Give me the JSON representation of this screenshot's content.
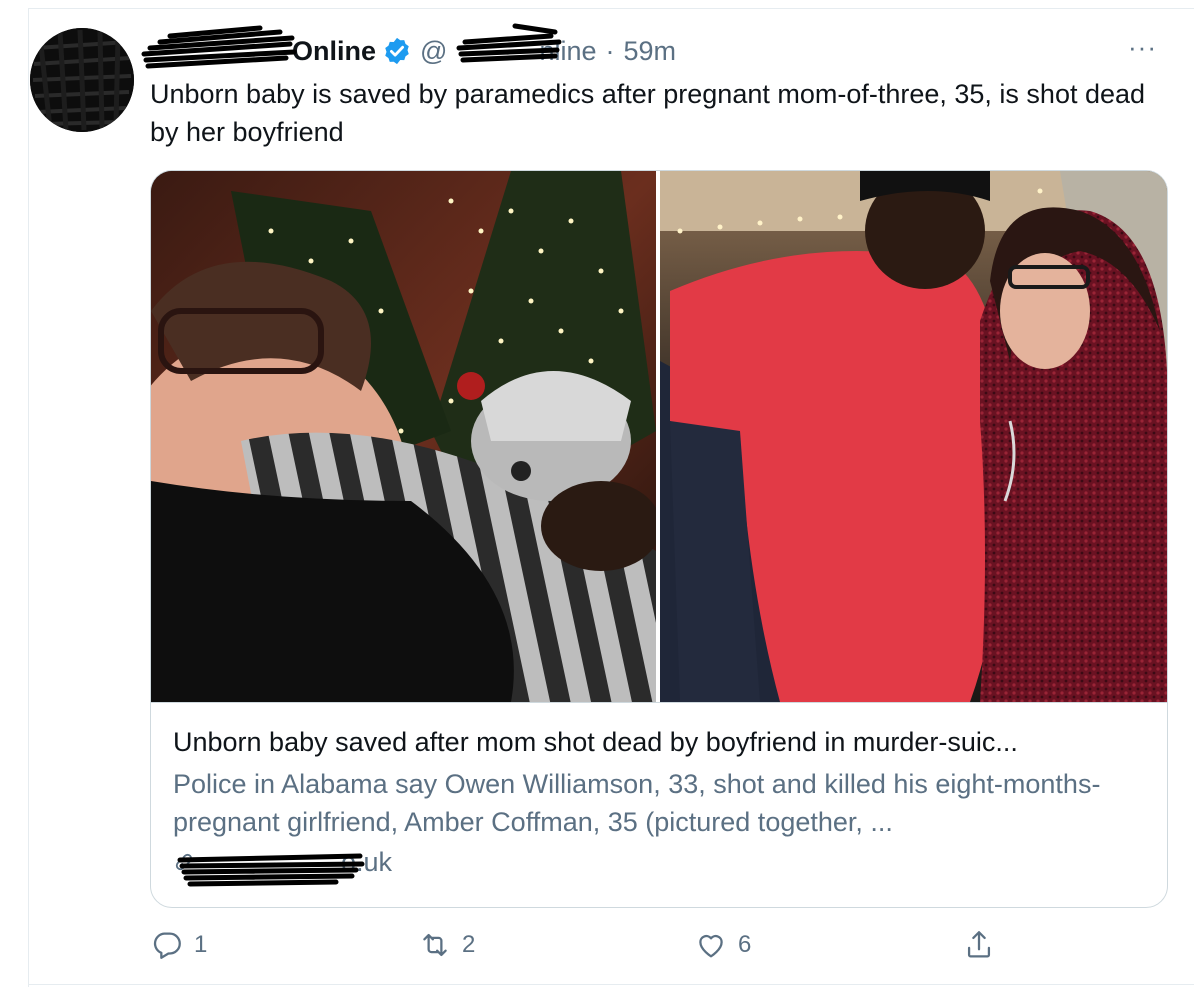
{
  "tweet": {
    "author": {
      "display_name": "Online",
      "handle": "@",
      "handle_suffix": "nline",
      "verified": true
    },
    "separator": "·",
    "time": "59m",
    "more_label": "···",
    "text": "Unborn baby is saved by paramedics after pregnant mom-of-three, 35, is shot dead by her boyfriend"
  },
  "card": {
    "title": "Unborn baby saved after mom shot dead by boyfriend in murder-suic...",
    "description": "Police in Alabama say Owen Williamson, 33, shot and killed his eight-months-pregnant girlfriend, Amber Coffman, 35 (pictured together, ...",
    "domain": "o.uk"
  },
  "actions": {
    "reply_count": "1",
    "retweet_count": "2",
    "like_count": "6"
  },
  "colors": {
    "text_primary": "#0f1419",
    "text_secondary": "#5b7083",
    "verified_blue": "#1d9bf0",
    "border": "#cfd9de"
  },
  "icons": [
    "more-icon",
    "verified-badge-icon",
    "link-icon",
    "reply-icon",
    "retweet-icon",
    "like-icon",
    "share-icon"
  ]
}
